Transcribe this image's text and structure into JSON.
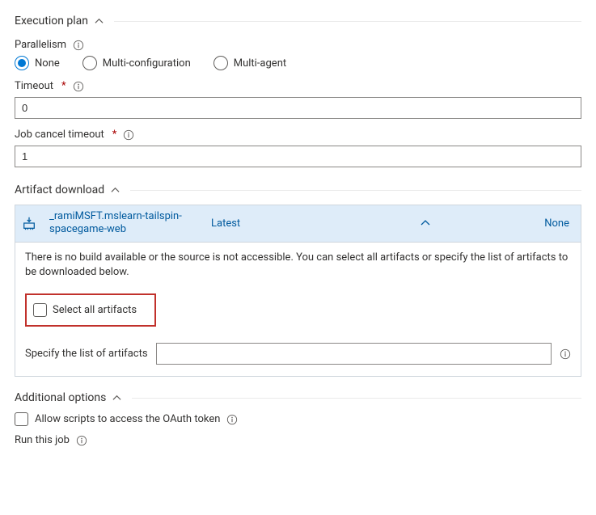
{
  "exec": {
    "title": "Execution plan",
    "parallelism_label": "Parallelism",
    "radios": {
      "none": "None",
      "multi_config": "Multi-configuration",
      "multi_agent": "Multi-agent",
      "selected": "none"
    },
    "timeout_label": "Timeout",
    "timeout_value": "0",
    "cancel_label": "Job cancel timeout",
    "cancel_value": "1"
  },
  "artifact": {
    "title": "Artifact download",
    "source_name": "_ramiMSFT.mslearn-tailspin-spacegame-web",
    "version": "Latest",
    "none_label": "None",
    "message": "There is no build available or the source is not accessible. You can select all artifacts or specify the list of artifacts to be downloaded below.",
    "select_all_label": "Select all artifacts",
    "specify_label": "Specify the list of artifacts",
    "specify_value": ""
  },
  "additional": {
    "title": "Additional options",
    "allow_scripts_label": "Allow scripts to access the OAuth token",
    "run_label": "Run this job"
  }
}
